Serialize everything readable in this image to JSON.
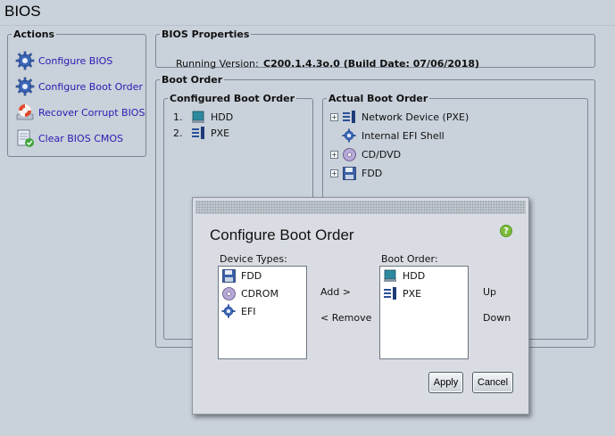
{
  "page": {
    "title": "BIOS"
  },
  "actions": {
    "legend": "Actions",
    "items": [
      {
        "label": "Configure BIOS",
        "icon": "gear-icon"
      },
      {
        "label": "Configure Boot Order",
        "icon": "gear-icon"
      },
      {
        "label": "Recover Corrupt BIOS",
        "icon": "lifebuoy-icon"
      },
      {
        "label": "Clear BIOS CMOS",
        "icon": "clear-cmos-icon"
      }
    ]
  },
  "bios_properties": {
    "legend": "BIOS Properties",
    "running_version_label": "Running Version:",
    "running_version_value": "C200.1.4.3o.0 (Build Date: 07/06/2018)"
  },
  "boot_order": {
    "legend": "Boot Order",
    "configured": {
      "legend": "Configured Boot Order",
      "items": [
        {
          "num": "1.",
          "label": "HDD",
          "icon": "hdd-icon"
        },
        {
          "num": "2.",
          "label": "PXE",
          "icon": "network-icon"
        }
      ]
    },
    "actual": {
      "legend": "Actual Boot Order",
      "items": [
        {
          "label": "Network Device (PXE)",
          "icon": "network-icon",
          "expandable": true
        },
        {
          "label": "Internal EFI Shell",
          "icon": "gear-icon",
          "expandable": false
        },
        {
          "label": "CD/DVD",
          "icon": "cd-icon",
          "expandable": true
        },
        {
          "label": "FDD",
          "icon": "floppy-icon",
          "expandable": true
        }
      ]
    }
  },
  "dialog": {
    "title": "Configure Boot Order",
    "help": "?",
    "device_types_label": "Device Types:",
    "device_types": [
      {
        "label": "FDD",
        "icon": "floppy-icon"
      },
      {
        "label": "CDROM",
        "icon": "cd-icon"
      },
      {
        "label": "EFI",
        "icon": "gear-icon"
      }
    ],
    "add_label": "Add >",
    "remove_label": "< Remove",
    "boot_order_label": "Boot Order:",
    "boot_order": [
      {
        "label": "HDD",
        "icon": "hdd-icon"
      },
      {
        "label": "PXE",
        "icon": "network-icon"
      }
    ],
    "up_label": "Up",
    "down_label": "Down",
    "apply_label": "Apply",
    "cancel_label": "Cancel"
  },
  "colors": {
    "background": "#c9d1da",
    "link": "#2a1ab3",
    "help_green": "#7dbb3c"
  }
}
